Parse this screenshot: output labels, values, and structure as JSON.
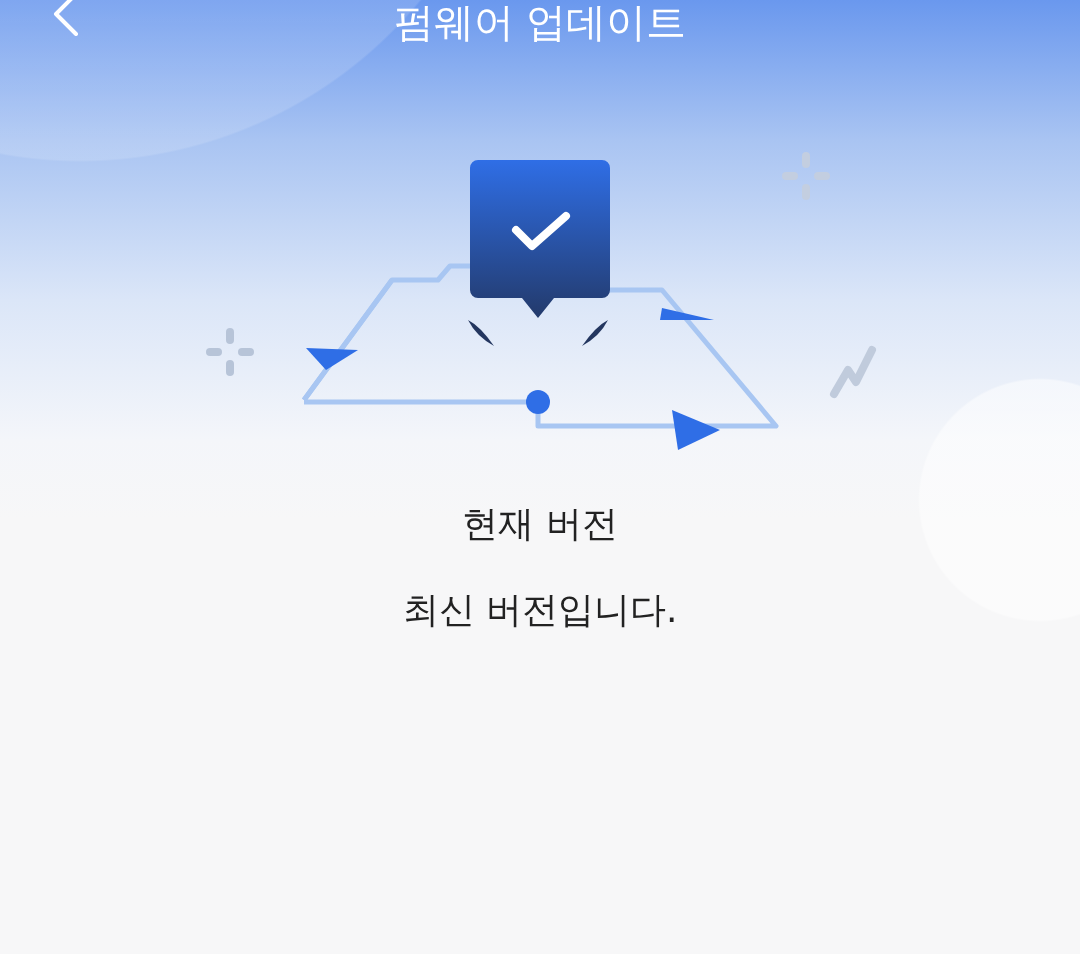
{
  "header": {
    "title": "펌웨어 업데이트"
  },
  "version": {
    "label": "현재 버전",
    "status": "최신 버전입니다."
  }
}
